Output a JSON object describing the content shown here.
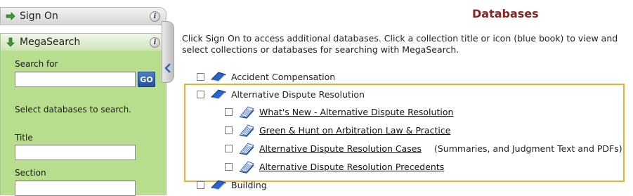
{
  "sidebar": {
    "sign_on_label": "Sign On",
    "megasearch_label": "MegaSearch",
    "search_for_label": "Search for",
    "go_label": "GO",
    "select_text": "Select databases to search.",
    "title_label": "Title",
    "section_label": "Section"
  },
  "main": {
    "title": "Databases",
    "intro": "Click Sign On to access additional databases. Click a collection title or icon (blue book) to view and select collections or databases for searching with MegaSearch.",
    "collections": [
      {
        "label": "Accident Compensation"
      },
      {
        "label": "Alternative Dispute Resolution"
      },
      {
        "label": "Building"
      }
    ],
    "databases": [
      {
        "label": "What's New - Alternative Dispute Resolution"
      },
      {
        "label": "Green & Hunt on Arbitration Law & Practice"
      },
      {
        "label": "Alternative Dispute Resolution Cases",
        "note": "(Summaries, and Judgment Text and PDFs)"
      },
      {
        "label": "Alternative Dispute Resolution Precedents"
      }
    ]
  },
  "colors": {
    "sidebar_green": "#b7dd8d",
    "title_red": "#8b2323",
    "highlight_orange": "#f0ad2d",
    "go_blue": "#1f4f9f"
  },
  "icons": {
    "collection": "blue-book-icon",
    "database": "document-page-icon",
    "info": "info-icon",
    "collapse": "chevron-left-icon"
  }
}
